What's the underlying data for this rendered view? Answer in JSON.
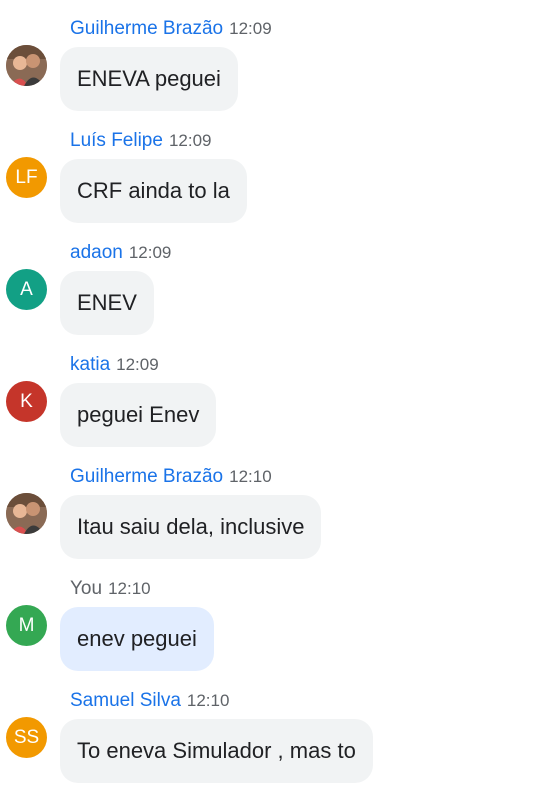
{
  "messages": [
    {
      "sender": "Guilherme Brazão",
      "time": "12:09",
      "text": "ENEVA peguei",
      "avatar": {
        "type": "photo",
        "icon": "person-photo-icon"
      },
      "self": false
    },
    {
      "sender": "Luís Felipe",
      "time": "12:09",
      "text": "CRF ainda to la",
      "avatar": {
        "type": "initials",
        "initials": "LF",
        "color": "#f29900"
      },
      "self": false
    },
    {
      "sender": "adaon",
      "time": "12:09",
      "text": "ENEV",
      "avatar": {
        "type": "initials",
        "initials": "A",
        "color": "#12a085"
      },
      "self": false
    },
    {
      "sender": "katia",
      "time": "12:09",
      "text": "peguei Enev",
      "avatar": {
        "type": "initials",
        "initials": "K",
        "color": "#c5352a"
      },
      "self": false
    },
    {
      "sender": "Guilherme Brazão",
      "time": "12:10",
      "text": "Itau saiu dela, inclusive",
      "avatar": {
        "type": "photo",
        "icon": "person-photo-icon"
      },
      "self": false
    },
    {
      "sender": "You",
      "time": "12:10",
      "text": "enev peguei",
      "avatar": {
        "type": "initials",
        "initials": "M",
        "color": "#34a853"
      },
      "self": true
    },
    {
      "sender": "Samuel Silva",
      "time": "12:10",
      "text": "To eneva Simulador , mas to",
      "avatar": {
        "type": "initials",
        "initials": "SS",
        "color": "#f29900"
      },
      "self": false
    }
  ]
}
